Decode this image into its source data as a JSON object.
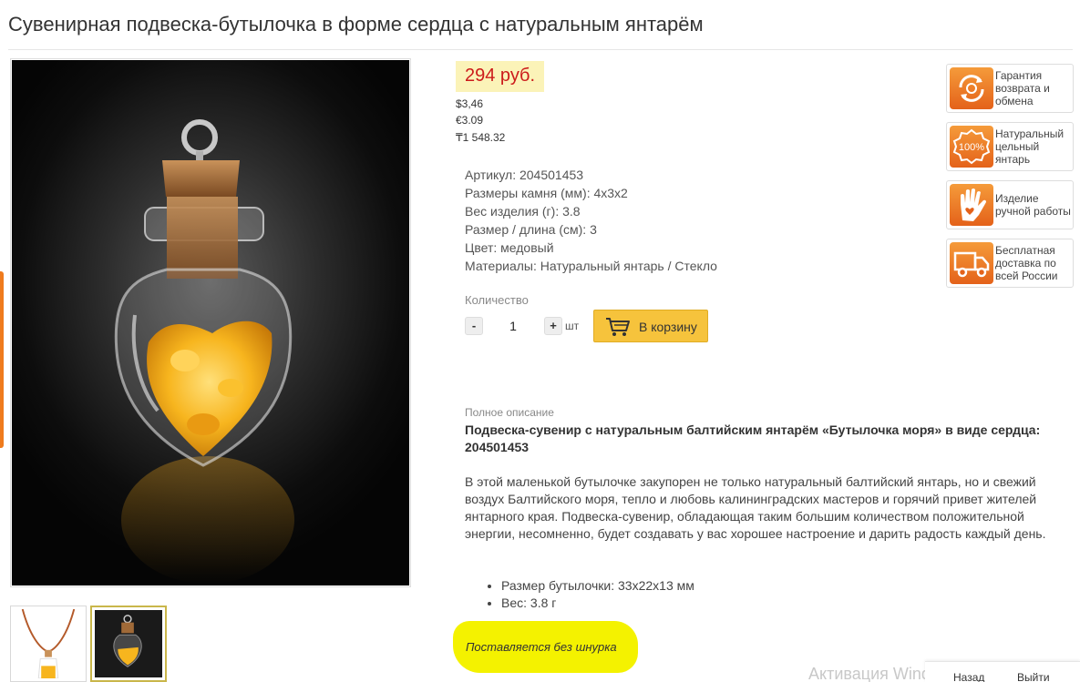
{
  "page": {
    "title": "Сувенирная подвеска-бутылочка в форме сердца с натуральным янтарём"
  },
  "pricing": {
    "price": "294 руб.",
    "usd": "$3,46",
    "eur": "€3.09",
    "kzt": "₸1 548.32",
    "highlight_color": "#fbf3b8",
    "price_color": "#cc1b1b"
  },
  "specs": [
    "Артикул: 204501453",
    "Размеры камня (мм): 4х3х2",
    "Вес изделия (г): 3.8",
    "Размер / длина (см): 3",
    "Цвет: медовый",
    "Материалы: Натуральный янтарь / Стекло"
  ],
  "quantity": {
    "label": "Количество",
    "minus": "-",
    "value": "1",
    "plus": "+",
    "unit": "шт"
  },
  "cart": {
    "label": "В корзину",
    "icon": "cart-icon",
    "color": "#f6c33c"
  },
  "description": {
    "heading": "Полное описание",
    "title": "Подвеска-сувенир с натуральным балтийским янтарём «Бутылочка моря» в виде сердца: 204501453",
    "text": "В этой маленькой бутылочке закупорен не только натуральный балтийский янтарь, но и свежий воздух Балтийского моря, тепло и любовь калининградских мастеров и горячий привет жителей янтарного края. Подвеска-сувенир, обладающая таким большим количеством положительной энергии, несомненно, будет создавать у вас хорошее настроение и дарить радость каждый день.",
    "bullets": [
      "Размер бутылочки: 33х22х13 мм",
      "Вес: 3.8 г"
    ],
    "note": "Поставляется без шнурка",
    "note_highlight": "#f4f200"
  },
  "badges": [
    {
      "icon": "return-exchange-icon",
      "text": "Гарантия возврата и обмена"
    },
    {
      "icon": "natural-100-icon",
      "text": "Натуральный цельный янтарь",
      "icon_text": "100%"
    },
    {
      "icon": "hand-heart-icon",
      "text": "Изделие ручной работы"
    },
    {
      "icon": "delivery-truck-icon",
      "text": "Бесплатная доставка по всей России"
    }
  ],
  "badge_color": "#e4621a",
  "windows_overlay": {
    "watermark": "Активация Windows",
    "btn_back": "Назад",
    "btn_next": "Выйти"
  }
}
